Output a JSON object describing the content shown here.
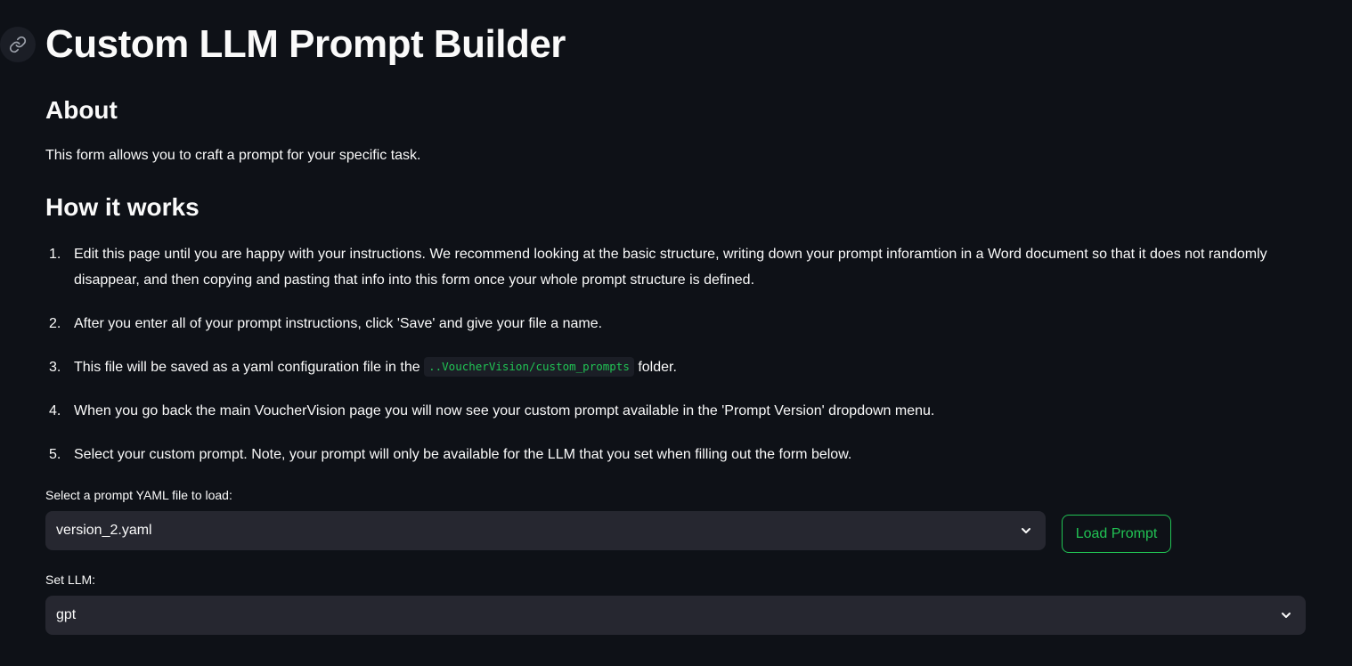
{
  "page": {
    "title": "Custom LLM Prompt Builder"
  },
  "about": {
    "heading": "About",
    "text": "This form allows you to craft a prompt for your specific task."
  },
  "how": {
    "heading": "How it works",
    "steps": [
      {
        "num": "1.",
        "text": "Edit this page until you are happy with your instructions. We recommend looking at the basic structure, writing down your prompt inforamtion in a Word document so that it does not randomly disappear, and then copying and pasting that info into this form once your whole prompt structure is defined."
      },
      {
        "num": "2.",
        "text": "After you enter all of your prompt instructions, click 'Save' and give your file a name."
      },
      {
        "num": "3.",
        "text_before": "This file will be saved as a yaml configuration file in the",
        "code": "..VoucherVision/custom_prompts",
        "text_after": "folder."
      },
      {
        "num": "4.",
        "text": "When you go back the main VoucherVision page you will now see your custom prompt available in the 'Prompt Version' dropdown menu."
      },
      {
        "num": "5.",
        "text": "Select your custom prompt. Note, your prompt will only be available for the LLM that you set when filling out the form below."
      }
    ]
  },
  "form": {
    "yaml_label": "Select a prompt YAML file to load:",
    "yaml_value": "version_2.yaml",
    "load_button": "Load Prompt",
    "llm_label": "Set LLM:",
    "llm_value": "gpt"
  },
  "icons": {
    "anchor": "link-icon",
    "dropdown": "chevron-down-icon"
  },
  "colors": {
    "background": "#0e1117",
    "accent": "#21c354",
    "input_bg": "#262730"
  }
}
